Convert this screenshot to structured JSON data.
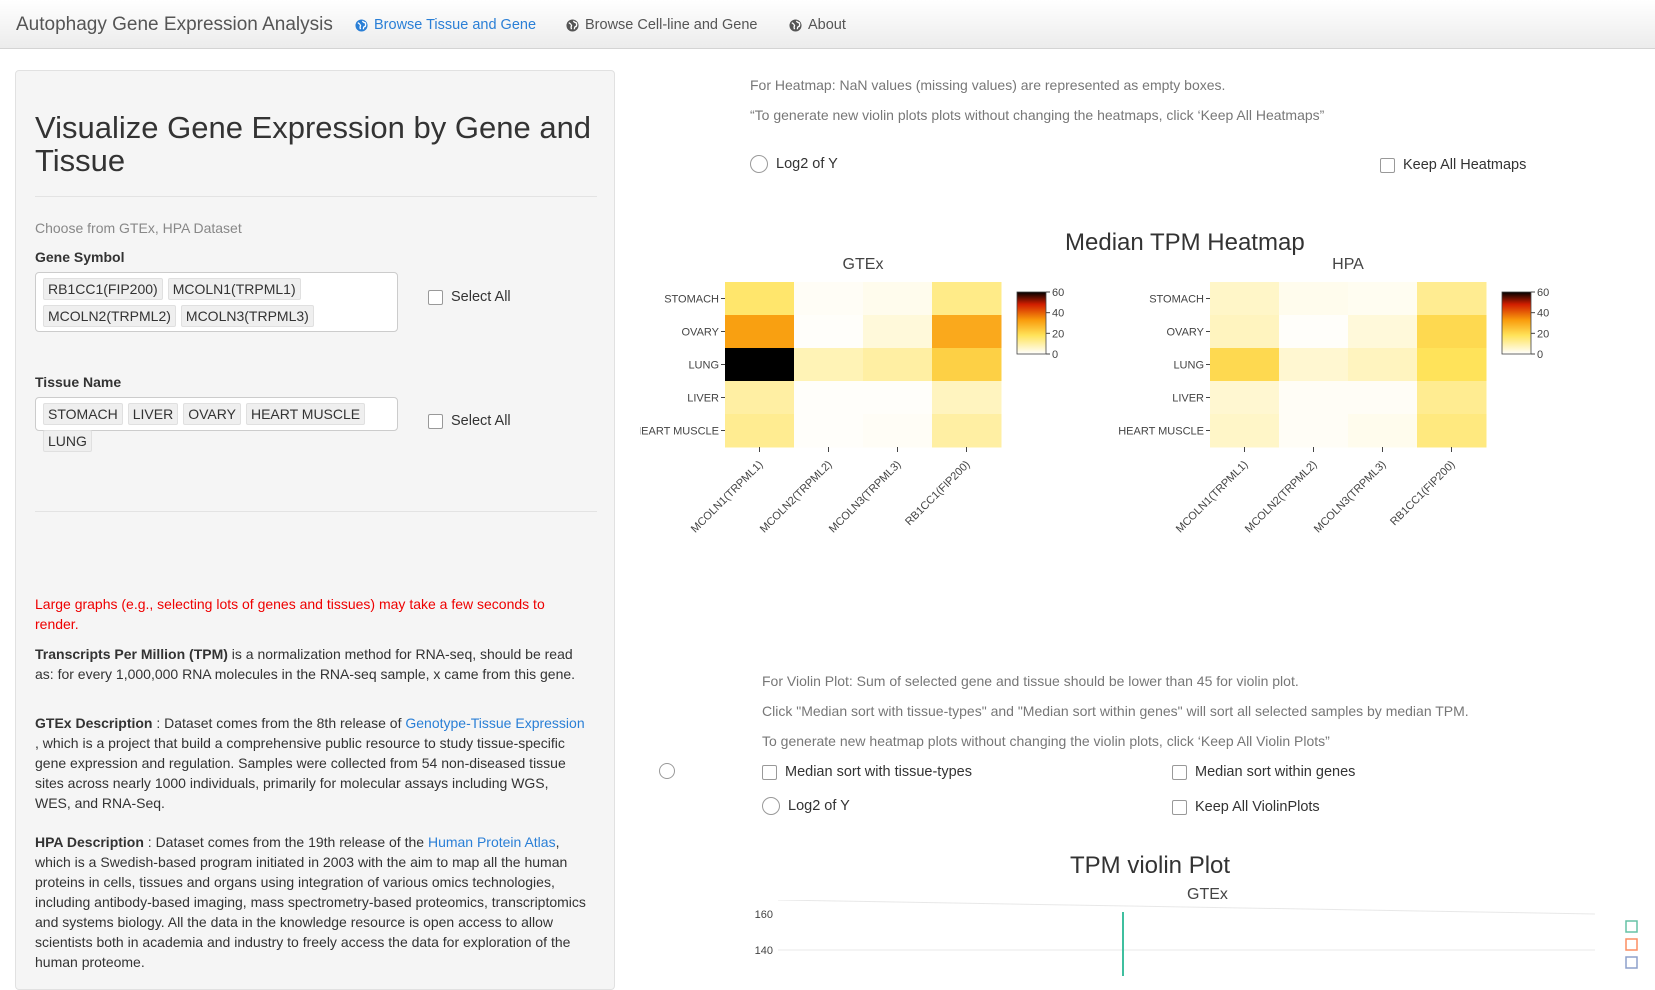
{
  "navbar": {
    "brand": "Autophagy Gene Expression Analysis",
    "tabs": [
      {
        "label": "Browse Tissue and Gene",
        "active": true
      },
      {
        "label": "Browse Cell-line and Gene",
        "active": false
      },
      {
        "label": "About",
        "active": false
      }
    ]
  },
  "sidebar": {
    "title": "Visualize Gene Expression by Gene and Tissue",
    "help_text": "Choose from GTEx, HPA Dataset",
    "gene_label": "Gene Symbol",
    "genes": [
      "RB1CC1(FIP200)",
      "MCOLN1(TRPML1)",
      "MCOLN2(TRPML2)",
      "MCOLN3(TRPML3)"
    ],
    "gene_select_all": "Select All",
    "tissue_label": "Tissue Name",
    "tissues": [
      "STOMACH",
      "LIVER",
      "OVARY",
      "HEART MUSCLE",
      "LUNG"
    ],
    "tissue_select_all": "Select All",
    "warning": "Large graphs (e.g., selecting lots of genes and tissues) may take a few seconds to render.",
    "tpm_bold": "Transcripts Per Million (TPM)",
    "tpm_text": " is a normalization method for RNA-seq, should be read as: for every 1,000,000 RNA molecules in the RNA-seq sample, x came from this gene.",
    "gtex_bold": "GTEx Description",
    "gtex_pre": " : Dataset comes from the 8th release of ",
    "gtex_link": "Genotype-Tissue Expression",
    "gtex_post": " , which is a project that build a comprehensive public resource to study tissue-specific gene expression and regulation. Samples were collected from 54 non-diseased tissue sites across nearly 1000 individuals, primarily for molecular assays including WGS, WES, and RNA-Seq.",
    "hpa_bold": "HPA Description",
    "hpa_pre": " : Dataset comes from the 19th release of the ",
    "hpa_link": "Human Protein Atlas",
    "hpa_post": ", which is a Swedish-based program initiated in 2003 with the aim to map all the human proteins in cells, tissues and organs using integration of various omics technologies, including antibody-based imaging, mass spectrometry-based proteomics, transcriptomics and systems biology. All the data in the knowledge resource is open access to allow scientists both in academia and industry to freely access the data for exploration of the human proteome."
  },
  "heatmap_section": {
    "note1": "For Heatmap: NaN values (missing values) are represented as empty boxes.",
    "note2": "“To generate new violin plots plots without changing the heatmaps, click ‘Keep All Heatmaps”",
    "log2_label": "Log2 of Y",
    "keep_label": "Keep All Heatmaps",
    "title": "Median TPM Heatmap"
  },
  "violin_section": {
    "note1": "For Violin Plot: Sum of selected gene and tissue should be lower than 45 for violin plot.",
    "note2": "Click \"Median sort with tissue-types\" and \"Median sort within genes\" will sort all selected samples by median TPM.",
    "note3": "To generate new heatmap plots without changing the violin plots, click ‘Keep All Violin Plots”",
    "sort_tissue_label": "Median sort with tissue-types",
    "sort_gene_label": "Median sort within genes",
    "log2_label": "Log2 of Y",
    "keep_label": "Keep All ViolinPlots",
    "title": "TPM violin Plot",
    "subtitle": "GTEx",
    "y_ticks": [
      "160",
      "140"
    ]
  },
  "chart_data": [
    {
      "type": "heatmap",
      "title": "GTEx",
      "x": [
        "MCOLN1(TRPML1)",
        "MCOLN2(TRPML2)",
        "MCOLN3(TRPML3)",
        "RB1CC1(FIP200)"
      ],
      "y": [
        "STOMACH",
        "OVARY",
        "LUNG",
        "LIVER",
        "HEART MUSCLE"
      ],
      "z": [
        [
          16,
          1,
          2,
          13
        ],
        [
          32,
          0.5,
          4,
          30
        ],
        [
          60,
          8,
          10,
          22
        ],
        [
          10,
          0.5,
          0.5,
          7
        ],
        [
          12,
          0.5,
          1,
          10
        ]
      ],
      "colorbar_ticks": [
        "60",
        "40",
        "20",
        "0"
      ],
      "zmax": 60
    },
    {
      "type": "heatmap",
      "title": "HPA",
      "x": [
        "MCOLN1(TRPML1)",
        "MCOLN2(TRPML2)",
        "MCOLN3(TRPML3)",
        "RB1CC1(FIP200)"
      ],
      "y": [
        "STOMACH",
        "OVARY",
        "LUNG",
        "LIVER",
        "HEART MUSCLE"
      ],
      "z": [
        [
          6,
          2,
          1.5,
          12
        ],
        [
          7,
          0.5,
          4,
          20
        ],
        [
          20,
          5,
          7,
          18
        ],
        [
          5,
          1,
          1,
          12
        ],
        [
          6,
          1,
          2,
          14
        ]
      ],
      "colorbar_ticks": [
        "60",
        "40",
        "20",
        "0"
      ],
      "zmax": 60
    }
  ]
}
